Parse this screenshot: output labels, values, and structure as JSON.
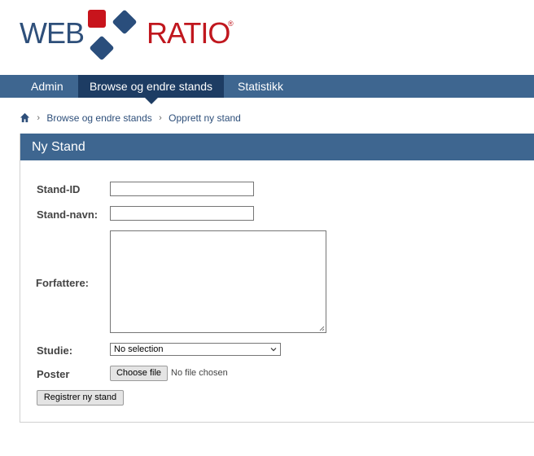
{
  "logo": {
    "part1": "WEB",
    "part2": "RATIO",
    "reg": "®"
  },
  "nav": {
    "items": [
      {
        "label": "Admin"
      },
      {
        "label": "Browse og endre stands"
      },
      {
        "label": "Statistikk"
      }
    ],
    "active_index": 1
  },
  "breadcrumb": {
    "home_icon": "home-icon",
    "items": [
      "Browse og endre stands",
      "Opprett ny stand"
    ],
    "separator": "›"
  },
  "form": {
    "title": "Ny Stand",
    "stand_id_label": "Stand-ID",
    "stand_id_value": "",
    "stand_navn_label": "Stand-navn:",
    "stand_navn_value": "",
    "forfattere_label": "Forfattere:",
    "forfattere_value": "",
    "studie_label": "Studie:",
    "studie_selected": "No selection",
    "poster_label": "Poster",
    "choose_file_label": "Choose file",
    "no_file_text": "No file chosen",
    "submit_label": "Registrer ny stand"
  },
  "colors": {
    "nav_bg": "#3e6690",
    "nav_active": "#1d3c63",
    "logo_blue": "#2e4f7a",
    "logo_red": "#c0171e"
  }
}
